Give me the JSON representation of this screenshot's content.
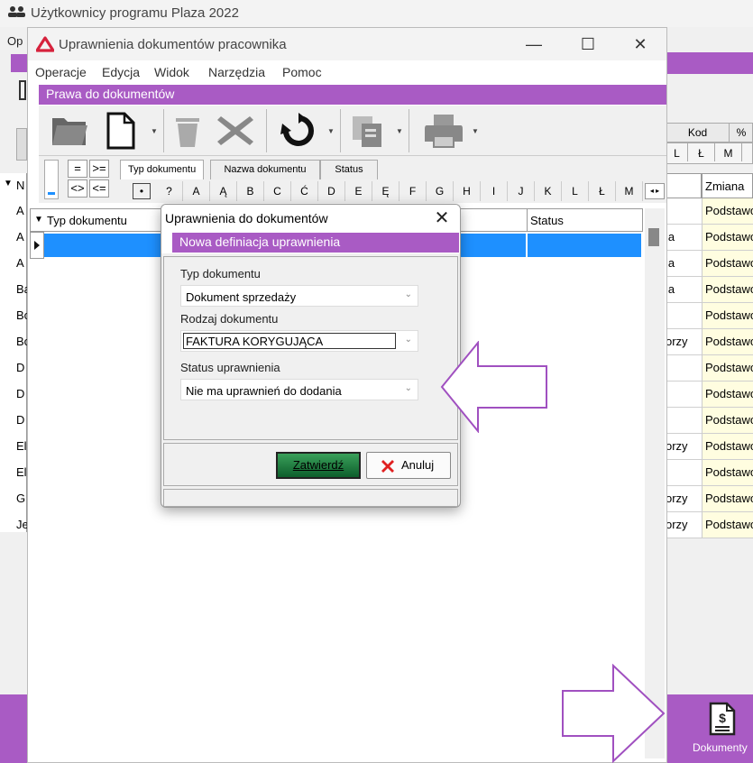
{
  "main_window": {
    "title": "Użytkownicy programu Plaza 2022",
    "menu_partial": "Op",
    "grid_header": [
      "Kod",
      "%"
    ],
    "letters": [
      "L",
      "Ł",
      "M"
    ],
    "zmiana_header": "Zmiana",
    "mid_values": [
      "",
      "ja",
      "ja",
      "ja",
      "",
      "orzy",
      "",
      "",
      "",
      "orzy",
      "",
      "orzy",
      "orzy"
    ],
    "zmiana_values": [
      "Podstawo",
      "Podstawo",
      "Podstawo",
      "Podstawo",
      "Podstawo",
      "Podstawo",
      "Podstawo",
      "Podstawo",
      "Podstawo",
      "Podstawo",
      "Podstawo",
      "Podstawo",
      "Podstawo"
    ],
    "left_letters": [
      "A",
      "A",
      "A",
      "Ba",
      "Bo",
      "Bo",
      "D",
      "D",
      "D",
      "El",
      "El",
      "G",
      "Je"
    ],
    "left_header": "N",
    "dokumenty_label": "Dokumenty"
  },
  "child_window": {
    "title": "Uprawnienia dokumentów pracownika",
    "menu": [
      "Operacje",
      "Edycja",
      "Widok",
      "Narzędzia",
      "Pomoc"
    ],
    "section_title": "Prawa do dokumentów",
    "operators": {
      "eq": "=",
      "ge": ">=",
      "ne": "<>",
      "le": "<="
    },
    "tabs": [
      "Typ dokumentu",
      "Nazwa dokumentu",
      "Status"
    ],
    "letters": [
      "•",
      "?",
      "A",
      "Ą",
      "B",
      "C",
      "Ć",
      "D",
      "E",
      "Ę",
      "F",
      "G",
      "H",
      "I",
      "J",
      "K",
      "L",
      "Ł",
      "M"
    ],
    "grid_columns": [
      "Typ dokumentu",
      "Status"
    ]
  },
  "dialog": {
    "title": "Uprawnienia do dokumentów",
    "subtitle": "Nowa  definiacja uprawnienia",
    "field1_label": "Typ dokumentu",
    "field1_value": "Dokument sprzedaży",
    "field2_label": "Rodzaj dokumentu",
    "field2_value": "FAKTURA KORYGUJĄCA",
    "field3_label": "Status uprawnienia",
    "field3_value": "Nie ma uprawnień do dodania",
    "ok_label": "Zatwierdź",
    "cancel_label": "Anuluj"
  },
  "colors": {
    "accent_purple": "#a95bc4",
    "selection_blue": "#1e90ff",
    "ok_green": "#1f7a3e",
    "cancel_red": "#e02020"
  }
}
